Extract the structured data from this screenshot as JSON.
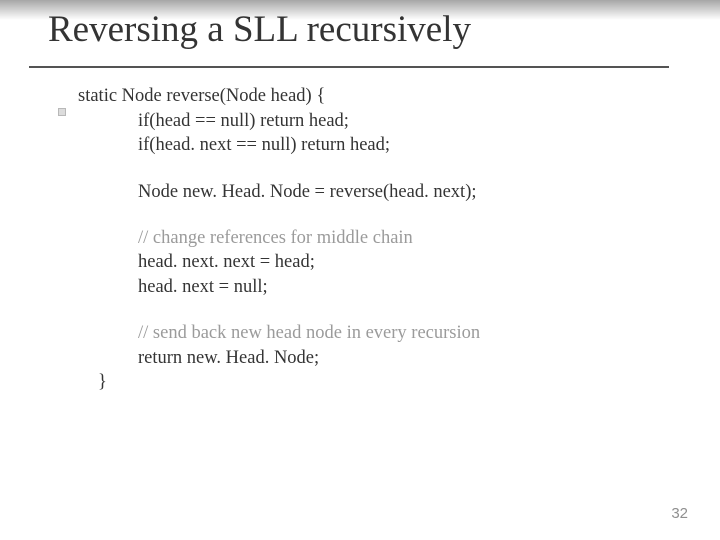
{
  "title": "Reversing a SLL recursively",
  "code": {
    "sig": "static Node reverse(Node head) {",
    "l1": "if(head == null)  return head;",
    "l2": "if(head. next == null)  return head;",
    "l3": "Node new. Head. Node = reverse(head. next);",
    "c1": "// change references for middle chain",
    "l4": "head. next. next = head;",
    "l5": "head. next = null;",
    "c2": "// send back new head node in every recursion",
    "l6": "return new. Head. Node;",
    "close": "}"
  },
  "pageNumber": "32"
}
